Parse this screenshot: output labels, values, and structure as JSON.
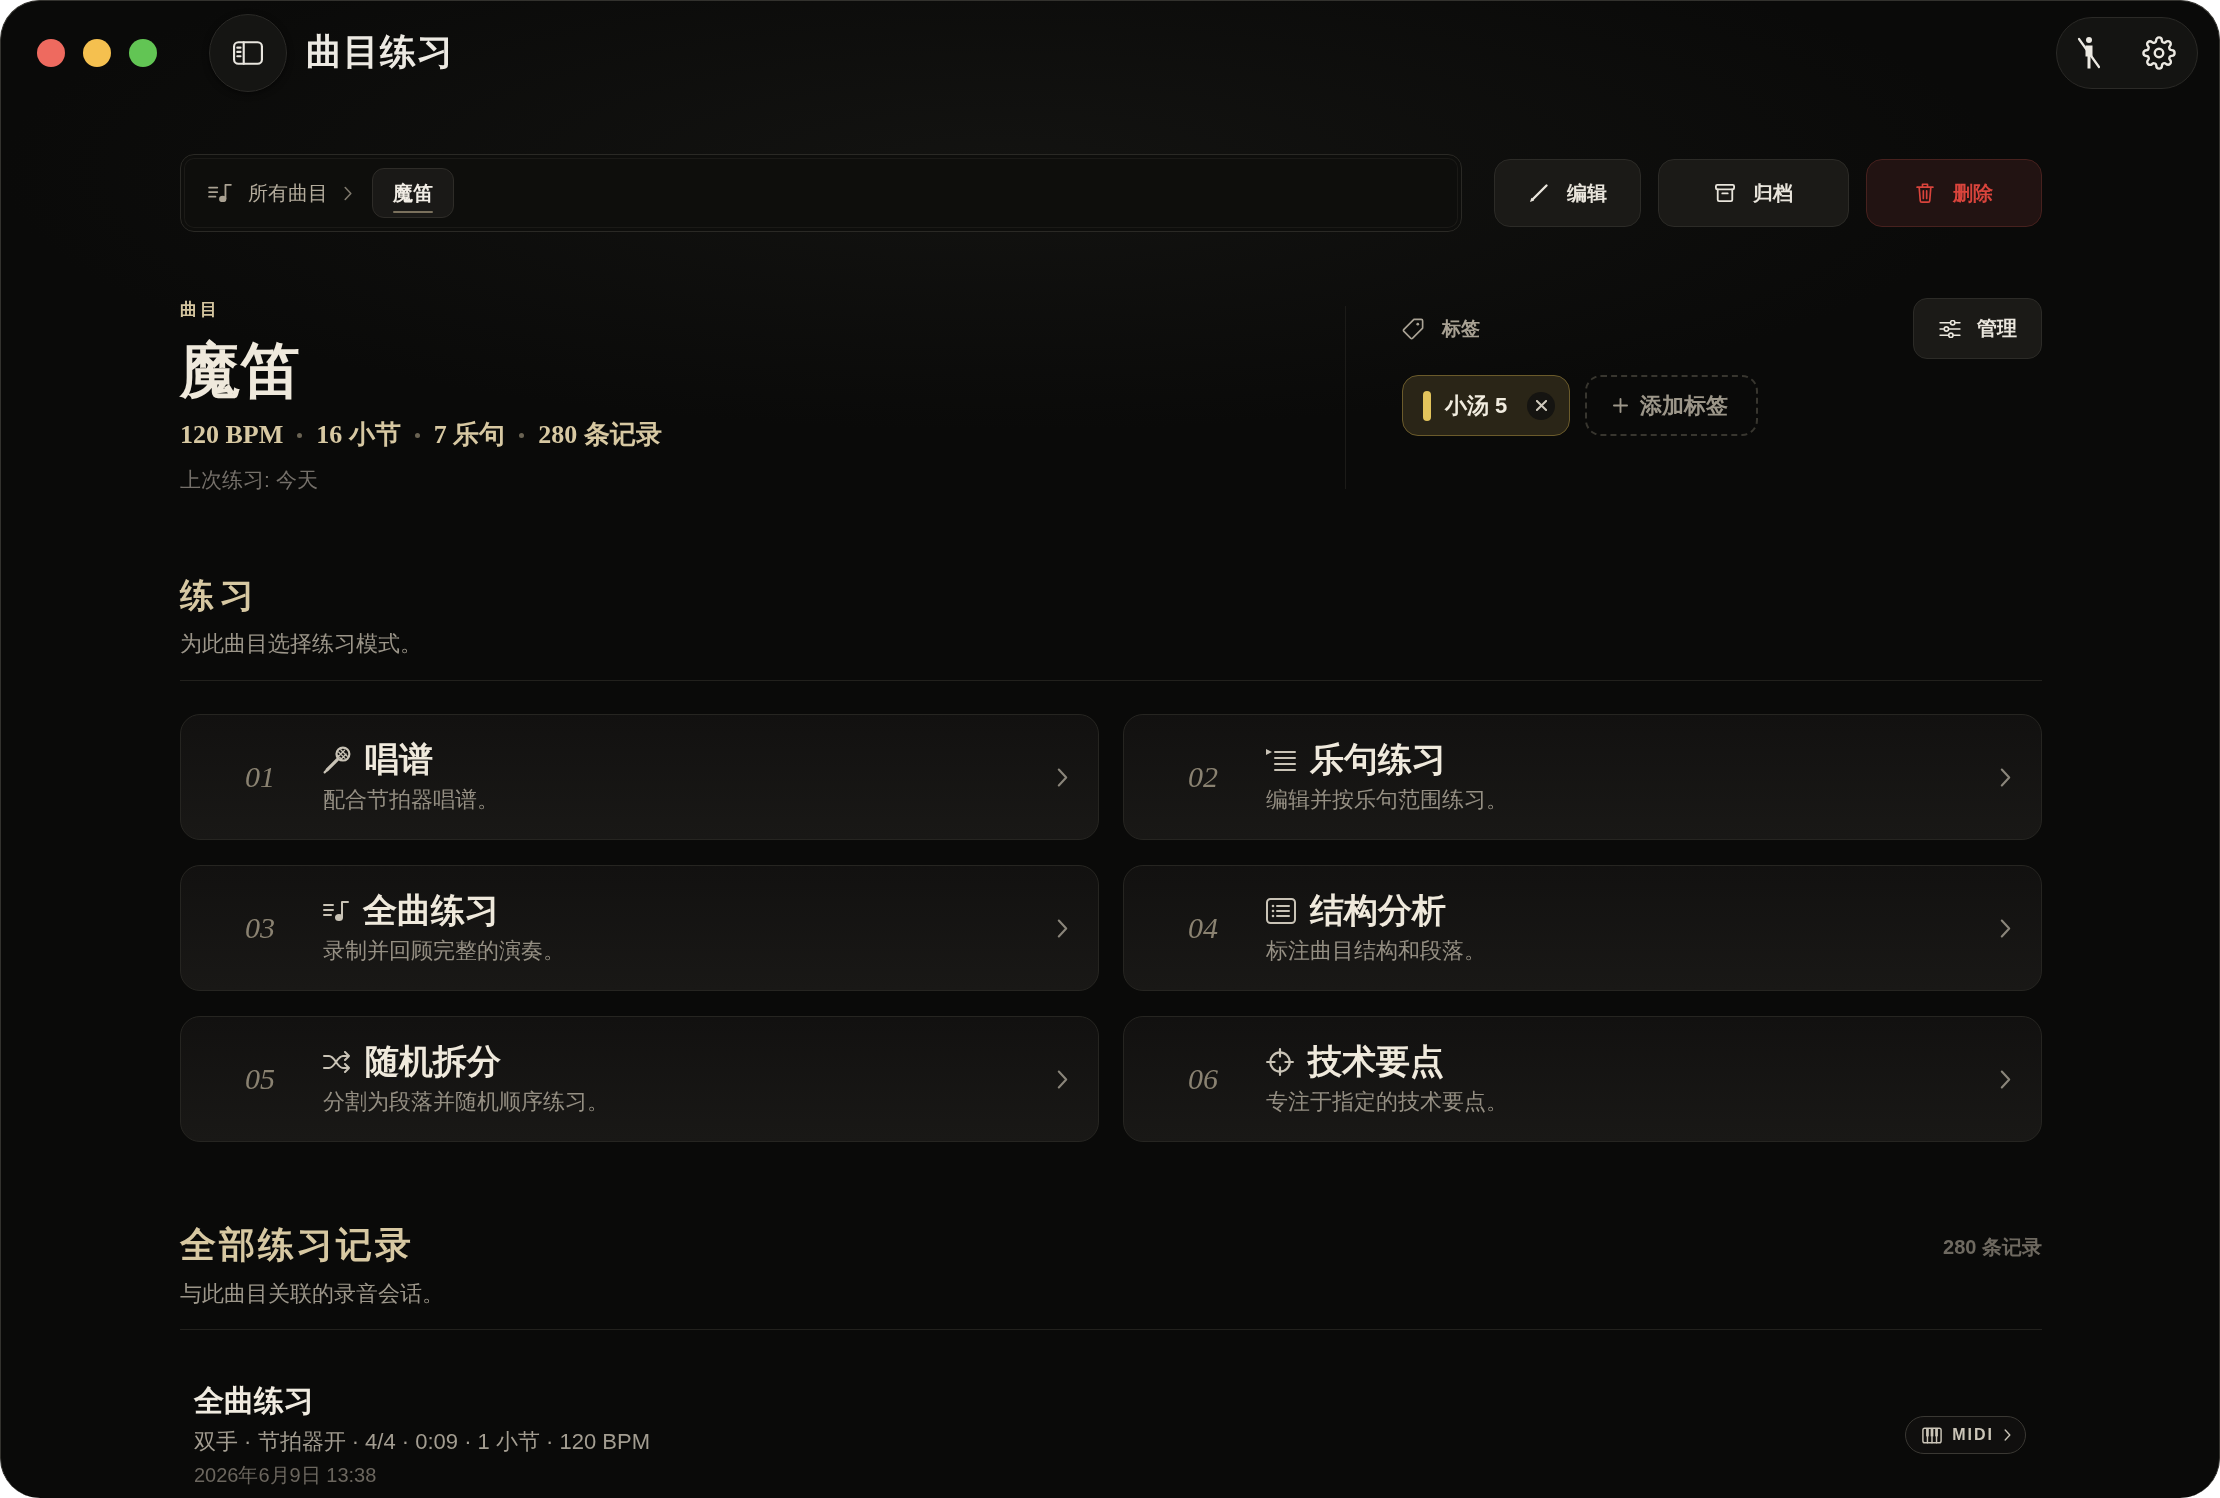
{
  "window": {
    "title": "曲目练习"
  },
  "breadcrumb": [
    {
      "label": "所有曲目",
      "selected": false
    },
    {
      "label": "魔笛",
      "selected": true
    }
  ],
  "actions": [
    {
      "kind": "edit",
      "label": "编辑"
    },
    {
      "kind": "archive",
      "label": "归档"
    },
    {
      "kind": "delete",
      "label": "删除"
    }
  ],
  "piece": {
    "eyebrow": "曲目",
    "title": "魔笛",
    "stats": [
      "120 BPM",
      "16 小节",
      "7 乐句",
      "280 条记录"
    ],
    "last_practiced": "上次练习: 今天"
  },
  "tags": {
    "heading": "标签",
    "manage": "管理",
    "items": [
      {
        "label": "小汤 5",
        "color": "#e3c45c"
      }
    ],
    "add": "添加标签"
  },
  "practice": {
    "heading": "练习",
    "subtitle": "为此曲目选择练习模式。",
    "modes": [
      {
        "number": "01",
        "kind": "sing",
        "title": "唱谱",
        "description": "配合节拍器唱谱。"
      },
      {
        "number": "02",
        "kind": "phrase",
        "title": "乐句练习",
        "description": "编辑并按乐句范围练习。"
      },
      {
        "number": "03",
        "kind": "full",
        "title": "全曲练习",
        "description": "录制并回顾完整的演奏。"
      },
      {
        "number": "04",
        "kind": "structure",
        "title": "结构分析",
        "description": "标注曲目结构和段落。"
      },
      {
        "number": "05",
        "kind": "shuffle",
        "title": "随机拆分",
        "description": "分割为段落并随机顺序练习。"
      },
      {
        "number": "06",
        "kind": "technique",
        "title": "技术要点",
        "description": "专注于指定的技术要点。"
      }
    ]
  },
  "records": {
    "heading": "全部练习记录",
    "subtitle": "与此曲目关联的录音会话。",
    "count": "280 条记录",
    "items": [
      {
        "title": "全曲练习",
        "meta": "双手 · 节拍器开 · 4/4 · 0:09 · 1 小节 · 120 BPM",
        "date": "2026年6月9日 13:38",
        "badge": "MIDI"
      }
    ]
  }
}
